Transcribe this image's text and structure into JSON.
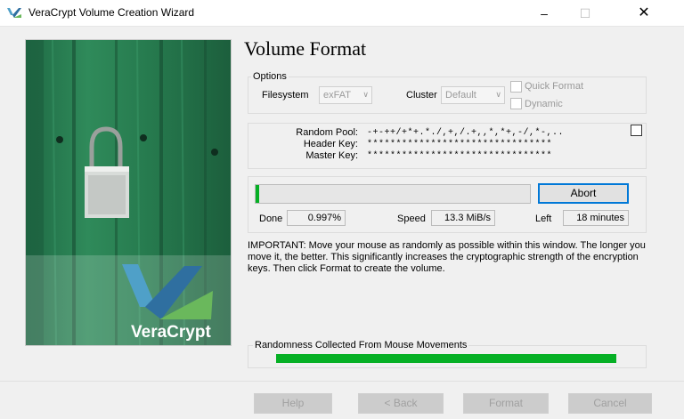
{
  "window": {
    "title": "VeraCrypt Volume Creation Wizard",
    "minimize_glyph": "–",
    "maximize_glyph": "☐",
    "close_glyph": "✕",
    "app_icon": "veracrypt-logo-icon"
  },
  "banner": {
    "brand": "VeraCrypt",
    "brand_colors": {
      "accent": "#4fa0c8",
      "accent2": "#2f6fa0"
    }
  },
  "page": {
    "heading": "Volume Format"
  },
  "options": {
    "group_label": "Options",
    "filesystem_label": "Filesystem",
    "filesystem_value": "exFAT",
    "cluster_label": "Cluster",
    "cluster_value": "Default",
    "quick_format_label": "Quick Format",
    "quick_format_checked": false,
    "dynamic_label": "Dynamic",
    "dynamic_checked": false
  },
  "keys": {
    "random_pool_label": "Random Pool:",
    "random_pool_value": "-+-++/+*+.*./,+,/.+,,*,*+,-/,*-,..",
    "header_key_label": "Header Key:",
    "header_key_value": "********************************",
    "master_key_label": "Master Key:",
    "master_key_value": "********************************",
    "show_checked": false
  },
  "progress": {
    "fraction": 0.00997,
    "abort_label": "Abort",
    "done_label": "Done",
    "done_value": "0.997%",
    "speed_label": "Speed",
    "speed_value": "13.3 MiB/s",
    "left_label": "Left",
    "left_value": "18 minutes"
  },
  "important_text": "IMPORTANT: Move your mouse as randomly as possible within this window. The longer you move it, the better. This significantly increases the cryptographic strength of the encryption keys. Then click Format to create the volume.",
  "randomness": {
    "label": "Randomness Collected From Mouse Movements",
    "fraction": 1.0,
    "color": "#06b025"
  },
  "footer": {
    "help_label": "Help",
    "back_label": "< Back",
    "format_label": "Format",
    "cancel_label": "Cancel"
  }
}
